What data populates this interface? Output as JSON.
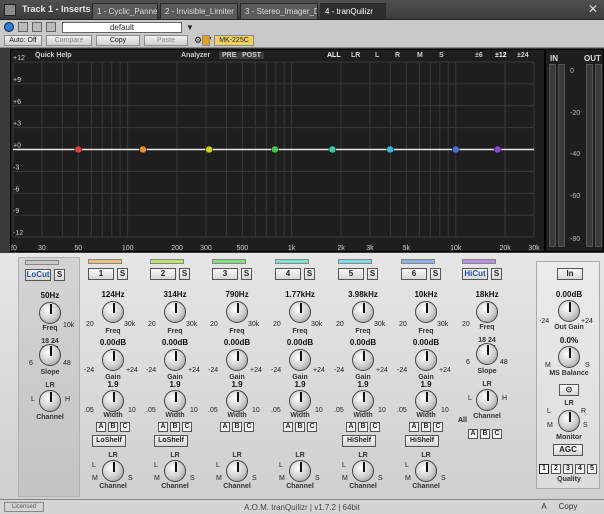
{
  "window": {
    "title": "Track 1 - Inserts",
    "tabs": [
      {
        "label": "1 - Cyclic_Panner"
      },
      {
        "label": "2 - Invisible_Limiter"
      },
      {
        "label": "3 - Stereo_Imager_D"
      },
      {
        "label": "4 - tranQuilizr"
      }
    ],
    "active_tab": 3
  },
  "toolbar": {
    "preset": "default",
    "auto_off": "Auto: Off",
    "compare": "Compare",
    "copy": "Copy",
    "paste": "Paste",
    "midi_device": "MK-225C"
  },
  "display": {
    "quick_help": "Quick Help",
    "analyzer": "Analyzer",
    "pre": "PRE",
    "post": "POST",
    "channel_modes": [
      "ALL",
      "LR",
      "L",
      "R",
      "M",
      "S"
    ],
    "active_mode": "ALL",
    "ranges": [
      "±6",
      "±12",
      "±24"
    ],
    "active_range": "±12",
    "db_labels": [
      "+12",
      "+9",
      "+6",
      "+3",
      "+0",
      "-3",
      "-6",
      "-9",
      "-12"
    ],
    "freq_labels": [
      "20",
      "30",
      "50",
      "100",
      "200",
      "300",
      "500",
      "1k",
      "2k",
      "3k",
      "5k",
      "10k",
      "20k",
      "30k"
    ],
    "freq_values": [
      20,
      30,
      50,
      100,
      200,
      300,
      500,
      1000,
      2000,
      3000,
      5000,
      10000,
      20000,
      30000
    ],
    "nodes": [
      {
        "freq": 50,
        "color": "#d84040"
      },
      {
        "freq": 124,
        "color": "#e89030"
      },
      {
        "freq": 314,
        "color": "#c8d020"
      },
      {
        "freq": 790,
        "color": "#48c848"
      },
      {
        "freq": 1770,
        "color": "#38c8a0"
      },
      {
        "freq": 3980,
        "color": "#38b8d8"
      },
      {
        "freq": 10000,
        "color": "#4a70d8"
      },
      {
        "freq": 18000,
        "color": "#8848d8"
      }
    ]
  },
  "meters": {
    "in_label": "IN",
    "out_label": "OUT",
    "ticks": [
      "0",
      "-20",
      "-40",
      "-60",
      "-80"
    ]
  },
  "bands": [
    {
      "name": "LoCut",
      "color": "#c8c8c8",
      "freq": "50Hz",
      "freq_min": "",
      "freq_max": "10k",
      "slope_label": "Slope",
      "slope_ticks": "18 24",
      "slope_side": "12 36",
      "slope_low": "6",
      "slope_high": "48",
      "channel_label": "Channel",
      "channel_top": "LR",
      "channel_l": "L",
      "channel_h": "H"
    },
    {
      "name": "1",
      "color": "#e8c080",
      "freq": "124Hz",
      "freq_min": "20",
      "freq_max": "30k",
      "gain": "0.00dB",
      "width": "1.9",
      "shelf": "LoShelf"
    },
    {
      "name": "2",
      "color": "#c0e070",
      "freq": "314Hz",
      "freq_min": "20",
      "freq_max": "30k",
      "gain": "0.00dB",
      "width": "1.9",
      "shelf": "LoShelf"
    },
    {
      "name": "3",
      "color": "#80e080",
      "freq": "790Hz",
      "freq_min": "20",
      "freq_max": "30k",
      "gain": "0.00dB",
      "width": "1.9"
    },
    {
      "name": "4",
      "color": "#80e0c8",
      "freq": "1.77kHz",
      "freq_min": "20",
      "freq_max": "30k",
      "gain": "0.00dB",
      "width": "1.9"
    },
    {
      "name": "5",
      "color": "#80d8e8",
      "freq": "3.98kHz",
      "freq_min": "20",
      "freq_max": "30k",
      "gain": "0.00dB",
      "width": "1.9",
      "shelf": "HiShelf"
    },
    {
      "name": "6",
      "color": "#90b0e8",
      "freq": "10kHz",
      "freq_min": "20",
      "freq_max": "30k",
      "gain": "0.00dB",
      "width": "1.9",
      "shelf": "HiShelf"
    },
    {
      "name": "HiCut",
      "color": "#b890e0",
      "freq": "18kHz",
      "freq_min": "20",
      "freq_max": "",
      "slope_label": "Slope",
      "slope_ticks": "18 24",
      "slope_side": "12 36",
      "slope_low": "6",
      "slope_high": "48",
      "channel_label": "Channel",
      "channel_top": "LR",
      "channel_l": "L",
      "channel_h": "H"
    }
  ],
  "band_labels": {
    "freq": "Freq",
    "gain": "Gain",
    "width": "Width",
    "channel": "Channel",
    "gain_min": "-24",
    "gain_max": "+24",
    "width_min": ".05",
    "width_max": "10",
    "abc": [
      "A",
      "B",
      "C"
    ],
    "all": "All",
    "channel_top": "LR",
    "channel_l": "L",
    "channel_m": "M",
    "channel_s": "S"
  },
  "output": {
    "in_button": "In",
    "out_gain": "0.00dB",
    "out_gain_label": "Out Gain",
    "out_gain_min": "-24",
    "out_gain_max": "+24",
    "ms_balance": "0.0%",
    "ms_balance_label": "MS Balance",
    "ms_m": "M",
    "ms_s": "S",
    "monitor_label": "Monitor",
    "monitor_top": "LR",
    "monitor_l": "L",
    "monitor_r": "R",
    "monitor_m": "M",
    "monitor_s": "S",
    "agc": "AGC",
    "quality": [
      "1",
      "2",
      "3",
      "4",
      "5"
    ],
    "quality_selected": "1",
    "quality_label": "Quality"
  },
  "status": {
    "licensed": "Licensed",
    "product": "A.O.M. tranQuilizr | v1.7.2 | 64bit",
    "a": "A",
    "copy": "Copy"
  }
}
